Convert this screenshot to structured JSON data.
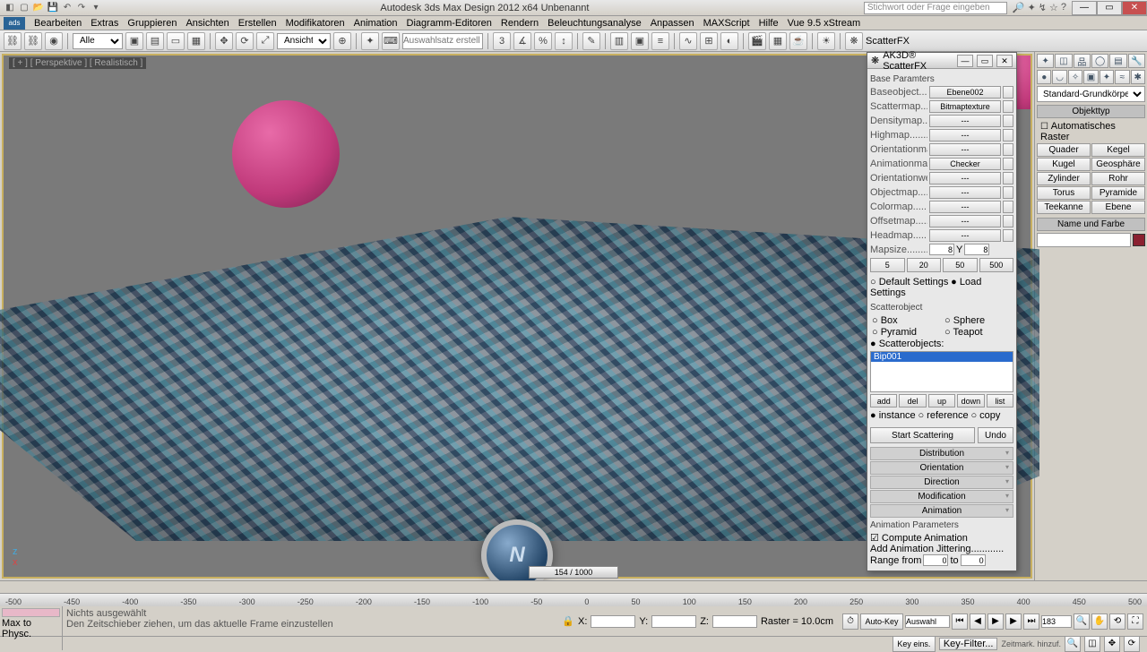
{
  "titlebar": {
    "title": "Autodesk 3ds Max Design 2012 x64     Unbenannt",
    "search_placeholder": "Stichwort oder Frage eingeben"
  },
  "menu": [
    "Bearbeiten",
    "Extras",
    "Gruppieren",
    "Ansichten",
    "Erstellen",
    "Modifikatoren",
    "Animation",
    "Diagramm-Editoren",
    "Rendern",
    "Beleuchtungsanalyse",
    "Anpassen",
    "MAXScript",
    "Hilfe",
    "Vue 9.5 xStream"
  ],
  "toolbar": {
    "sel_dropdown": "Alle",
    "view_label": "Ansicht",
    "named_sel_placeholder": "Auswahlsatz erstell",
    "scatterfx_label": "ScatterFX"
  },
  "viewport": {
    "label": "[ + ] [ Perspektive ] [ Realistisch ]"
  },
  "cmdpanel": {
    "category": "Standard-Grundkörper",
    "sec_objtype": "Objekttyp",
    "auto_raster": "Automatisches Raster",
    "prims": [
      "Quader",
      "Kegel",
      "Kugel",
      "Geosphäre",
      "Zylinder",
      "Rohr",
      "Torus",
      "Pyramide",
      "Teekanne",
      "Ebene"
    ],
    "sec_name": "Name und Farbe"
  },
  "dlg": {
    "title": "AK3D® ScatterFX",
    "sec_base": "Base Paramters",
    "params": [
      {
        "lbl": "Baseobject.......",
        "val": "Ebene002"
      },
      {
        "lbl": "Scattermap......",
        "val": "Bitmaptexture"
      },
      {
        "lbl": "Densitymap......",
        "val": "---"
      },
      {
        "lbl": "Highmap..........",
        "val": "---"
      },
      {
        "lbl": "Orientationmap..",
        "val": "---"
      },
      {
        "lbl": "Animationmap....",
        "val": "Checker"
      },
      {
        "lbl": "Orientationweigh",
        "val": "---"
      },
      {
        "lbl": "Objectmap.......",
        "val": "---"
      },
      {
        "lbl": "Colormap.........",
        "val": "---"
      },
      {
        "lbl": "Offsetmap........",
        "val": "---"
      },
      {
        "lbl": "Headmap.........",
        "val": "---"
      }
    ],
    "mapsize_lbl": "Mapsize......... X",
    "mapsize_x": "8",
    "mapsize_y_lbl": "Y",
    "mapsize_y": "8",
    "sizebtns": [
      "5",
      "20",
      "50",
      "500"
    ],
    "settings_default": "Default Settings",
    "settings_load": "Load Settings",
    "sec_scatter": "Scatterobject",
    "shapes": [
      "Box",
      "Sphere",
      "Pyramid",
      "Teapot"
    ],
    "so_label": "Scatterobjects:",
    "so_item": "Bip001",
    "listbtns": [
      "add",
      "del",
      "up",
      "down",
      "list"
    ],
    "inst_opts": [
      "instance",
      "reference",
      "copy"
    ],
    "btn_start": "Start Scattering",
    "btn_undo": "Undo",
    "rolls": [
      "Distribution",
      "Orientation",
      "Direction",
      "Modification",
      "Animation"
    ],
    "sec_anim": "Animation Parameters",
    "chk_compute": "Compute Animation",
    "lbl_jitter": "Add Animation Jittering............",
    "lbl_range_from": "Range from",
    "range_from": "0",
    "lbl_range_to": "to",
    "range_to": "0"
  },
  "timeline": {
    "ticks": [
      "-500",
      "-450",
      "-400",
      "-350",
      "-300",
      "-250",
      "-200",
      "-150",
      "-100",
      "-50",
      "0",
      "50",
      "100",
      "150",
      "200",
      "250",
      "300",
      "350",
      "400",
      "450",
      "500"
    ],
    "slider": "154 / 1000"
  },
  "status": {
    "max_to": "Max to Physc.",
    "line1": "Nichts ausgewählt",
    "line2": "Den Zeitschieber ziehen, um das aktuelle Frame einzustellen",
    "x": "X:",
    "y": "Y:",
    "z": "Z:",
    "raster": "Raster = 10.0cm",
    "autokey": "Auto-Key",
    "keyeins": "Key eins.",
    "sel_filter": "Auswahl",
    "key_filter": "Key-Filter...",
    "zeitmark": "Zeitmark. hinzuf.",
    "frame": "183"
  }
}
